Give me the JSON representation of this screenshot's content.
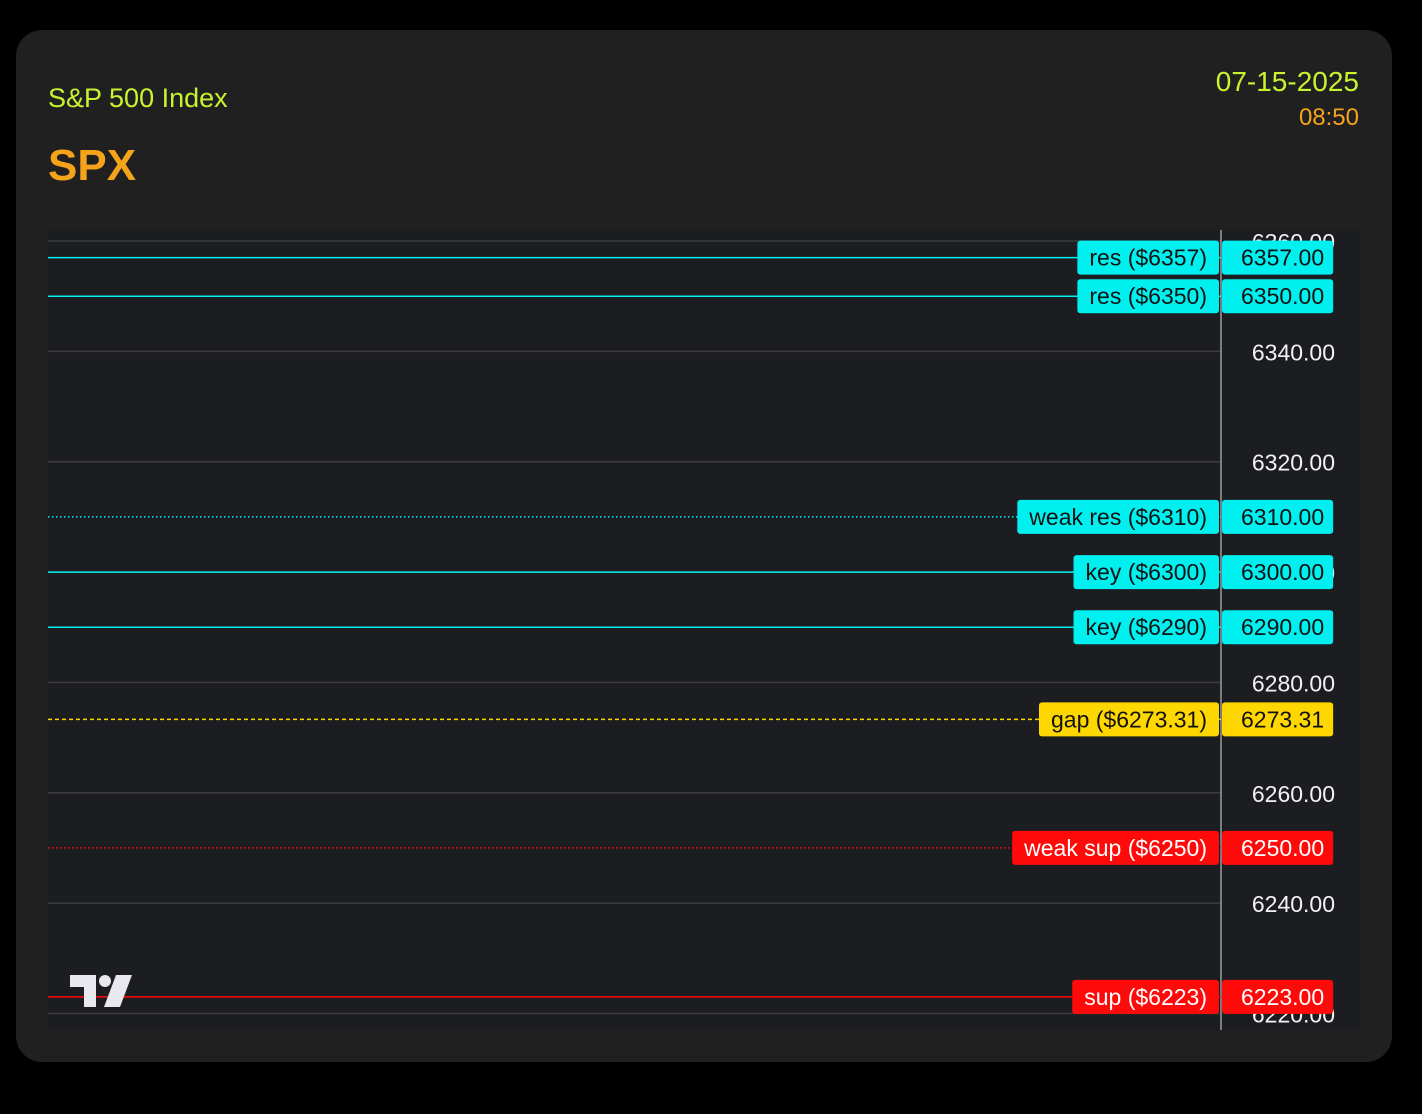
{
  "header": {
    "subtitle": "S&P 500 Index",
    "ticker": "SPX",
    "date": "07-15-2025",
    "time": "08:50"
  },
  "colors": {
    "card_bg": "#202021",
    "chart_bg": "#1c1d21",
    "resistance": "#00f0f0",
    "gap": "#ffd700",
    "support": "#ff0a0a",
    "subtitle": "#c9f22f",
    "ticker": "#f5a31a"
  },
  "chart_data": {
    "type": "line",
    "ylim": [
      6217,
      6362
    ],
    "y_ticks": [
      "6220.00",
      "6240.00",
      "6260.00",
      "6280.00",
      "6300.00",
      "6320.00",
      "6340.00",
      "6360.00"
    ],
    "levels": [
      {
        "label": "res ($6357)",
        "value": 6357,
        "price_label": "6357.00",
        "kind": "res",
        "style": "solid"
      },
      {
        "label": "res ($6350)",
        "value": 6350,
        "price_label": "6350.00",
        "kind": "res",
        "style": "solid"
      },
      {
        "label": "weak res ($6310)",
        "value": 6310,
        "price_label": "6310.00",
        "kind": "res",
        "style": "dotted"
      },
      {
        "label": "key ($6300)",
        "value": 6300,
        "price_label": "6300.00",
        "kind": "res",
        "style": "solid"
      },
      {
        "label": "key ($6290)",
        "value": 6290,
        "price_label": "6290.00",
        "kind": "res",
        "style": "solid"
      },
      {
        "label": "gap ($6273.31)",
        "value": 6273.31,
        "price_label": "6273.31",
        "kind": "gap",
        "style": "dashed"
      },
      {
        "label": "weak sup ($6250)",
        "value": 6250,
        "price_label": "6250.00",
        "kind": "sup",
        "style": "dotted"
      },
      {
        "label": "sup ($6223)",
        "value": 6223,
        "price_label": "6223.00",
        "kind": "sup",
        "style": "solid"
      }
    ]
  }
}
